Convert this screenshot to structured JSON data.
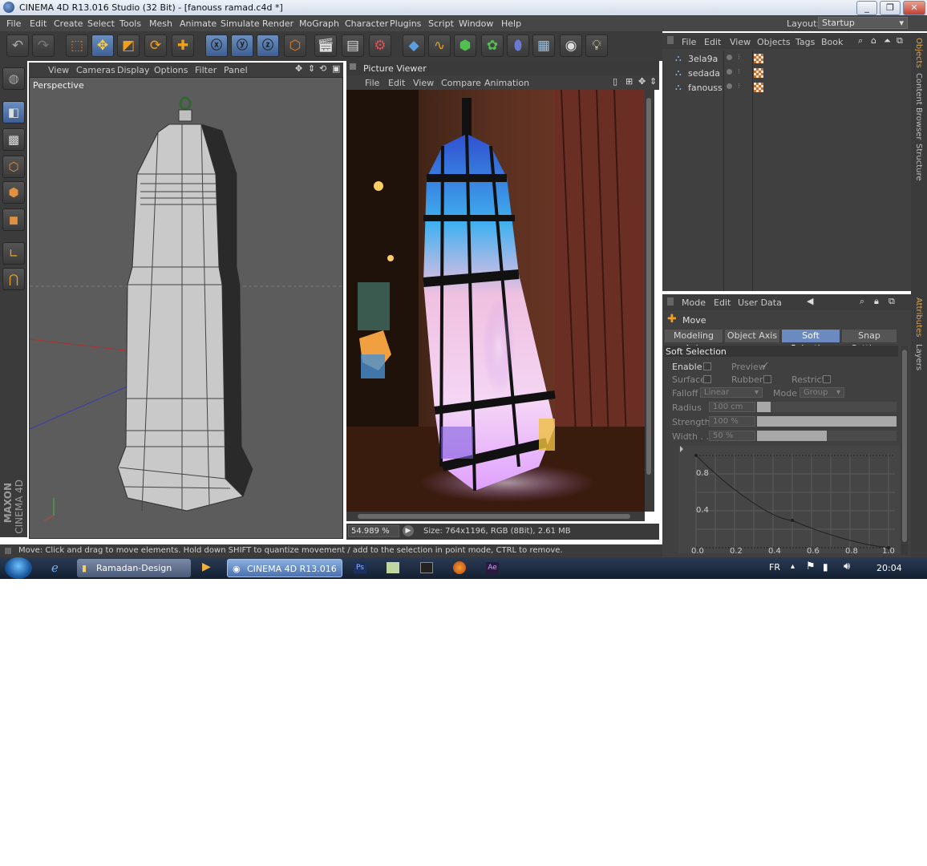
{
  "window": {
    "title": "CINEMA 4D R13.016 Studio (32 Bit) - [fanouss ramad.c4d *]",
    "min": "_",
    "max": "❐",
    "close": "✕"
  },
  "menu": [
    "File",
    "Edit",
    "Create",
    "Select",
    "Tools",
    "Mesh",
    "Animate",
    "Simulate",
    "Render",
    "MoGraph",
    "Character",
    "Plugins",
    "Script",
    "Window",
    "Help"
  ],
  "layout": {
    "label": "Layout:",
    "value": "Startup"
  },
  "viewport": {
    "menu": [
      "View",
      "Cameras",
      "Display",
      "Options",
      "Filter",
      "Panel"
    ],
    "label": "Perspective",
    "brand_maxon": "MAXON",
    "brand_c4d": "CINEMA 4D"
  },
  "picture_viewer": {
    "title": "Picture Viewer",
    "menu": [
      "File",
      "Edit",
      "View",
      "Compare",
      "Animation"
    ],
    "zoom": "54.989 %",
    "info": "Size: 764x1196, RGB (8Bit), 2.61 MB"
  },
  "objects": {
    "menu": [
      "File",
      "Edit",
      "View",
      "Objects",
      "Tags",
      "Book"
    ],
    "items": [
      "3ela9a",
      "sedada",
      "fanouss"
    ]
  },
  "side_tabs_top": [
    "Objects",
    "Content Browser",
    "Structure"
  ],
  "side_tabs_bottom": [
    "Attributes",
    "Layers"
  ],
  "attributes": {
    "menu": [
      "Mode",
      "Edit",
      "User Data"
    ],
    "tool": "Move",
    "tabs": [
      "Modeling Axis",
      "Object Axis",
      "Soft Selection",
      "Snap Settings"
    ],
    "active_tab": 2,
    "section": "Soft Selection",
    "enable": "Enable",
    "preview": "Preview",
    "preview_check": "✓",
    "surface": "Surface",
    "rubber": "Rubber",
    "restrict": "Restrict",
    "falloff_label": "Falloff",
    "falloff_value": "Linear",
    "mode_label": "Mode",
    "mode_value": "Group",
    "radius_label": "Radius",
    "radius_value": "100 cm",
    "radius_fill": 0.1,
    "strength_label": "Strength",
    "strength_value": "100 %",
    "strength_fill": 1.0,
    "width_label": "Width . .",
    "width_value": "50 %",
    "width_fill": 0.5,
    "graph_y_ticks": [
      "0.8",
      "0.4"
    ],
    "graph_x_ticks": [
      "0.0",
      "0.2",
      "0.4",
      "0.6",
      "0.8",
      "1.0"
    ]
  },
  "status": "Move: Click and drag to move elements. Hold down SHIFT to quantize movement / add to the selection in point mode, CTRL to remove.",
  "taskbar": {
    "items": [
      "Ramadan-Design",
      "CINEMA 4D R13.016 ..."
    ],
    "apps": [
      "Ps",
      "Ae"
    ],
    "lang": "FR",
    "time": "20:04"
  },
  "colors": {
    "accent": "#6a8ac0",
    "panel": "#404040",
    "dark": "#3b3b3b"
  }
}
